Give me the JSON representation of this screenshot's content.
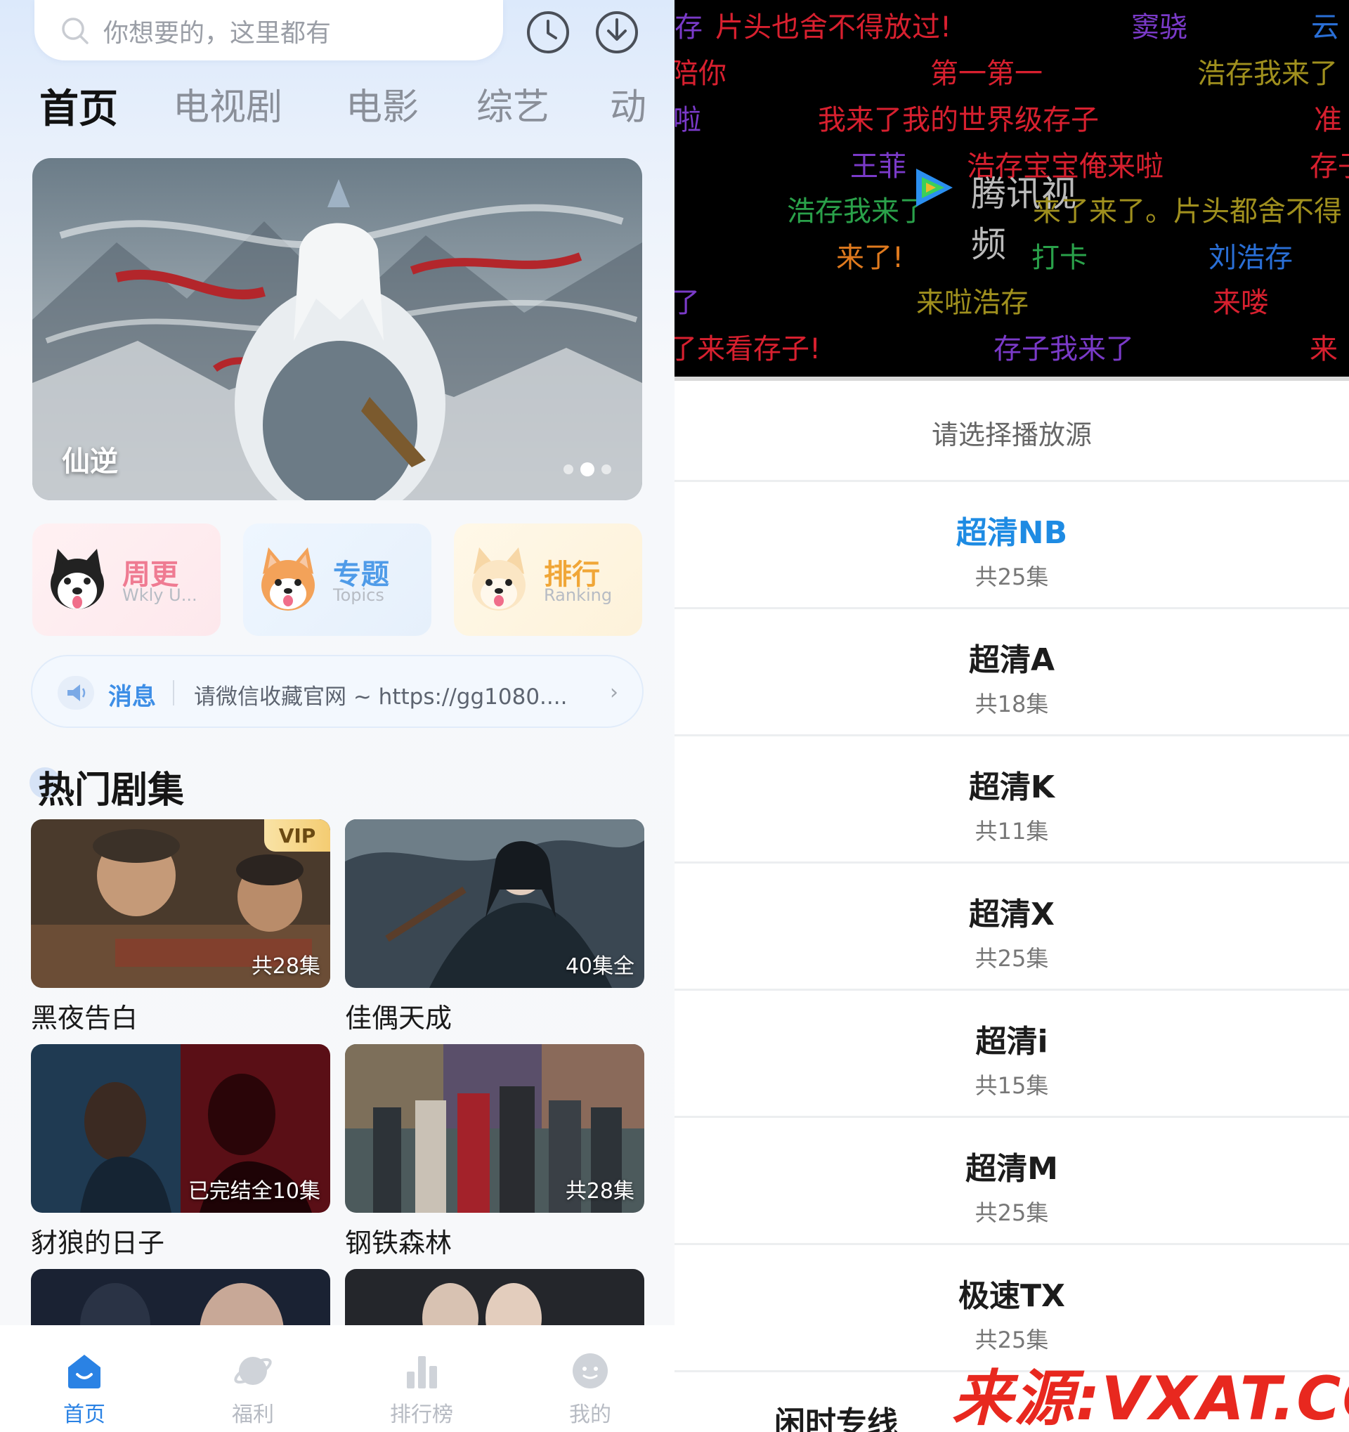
{
  "search": {
    "placeholder": "你想要的，这里都有"
  },
  "header_icons": [
    "history-icon",
    "download-icon"
  ],
  "tabs": [
    {
      "label": "首页",
      "active": true
    },
    {
      "label": "电视剧"
    },
    {
      "label": "电影"
    },
    {
      "label": "综艺"
    },
    {
      "label": "动"
    }
  ],
  "banner": {
    "title": "仙逆",
    "page_count": 3,
    "current_page": 2
  },
  "features": [
    {
      "title": "周更",
      "subtitle": "Wkly U...",
      "color": "#ef7b92",
      "icon": "husky-icon"
    },
    {
      "title": "专题",
      "subtitle": "Topics",
      "color": "#4f9be8",
      "icon": "corgi-icon"
    },
    {
      "title": "排行",
      "subtitle": "Ranking",
      "color": "#f0a637",
      "icon": "shiba-icon"
    }
  ],
  "notice": {
    "label": "消息",
    "text": "请微信收藏官网 ~ https://gg1080...."
  },
  "hot_section": {
    "title": "热门剧集",
    "items": [
      {
        "name": "黑夜告白",
        "badge": "共28集",
        "vip": "VIP"
      },
      {
        "name": "佳偶天成",
        "badge": "40集全"
      },
      {
        "name": "豺狼的日子",
        "badge": "已完结全10集"
      },
      {
        "name": "钢铁森林",
        "badge": "共28集"
      }
    ]
  },
  "bottom_nav": [
    {
      "label": "首页",
      "active": true,
      "icon": "home-icon"
    },
    {
      "label": "福利",
      "icon": "planet-icon"
    },
    {
      "label": "排行榜",
      "icon": "bar-chart-icon"
    },
    {
      "label": "我的",
      "icon": "profile-icon"
    }
  ],
  "player": {
    "logo_text": "腾讯视频",
    "danmaku": [
      "存",
      "片头也舍不得放过!",
      "窦骁",
      "云",
      "陪你",
      "第一第一",
      "浩存我来了",
      "啦",
      "我来了我的世界级存子",
      "准",
      "王菲",
      "浩存宝宝俺来啦",
      "存子",
      "浩存我来了",
      "来了来了。片头都舍不得",
      "来了!",
      "打卡",
      "刘浩存",
      "了",
      "来啦浩存",
      "来喽",
      "了来看存子!",
      "存子我来了",
      "来"
    ]
  },
  "source_picker": {
    "title": "请选择播放源",
    "sources": [
      {
        "name": "超清NB",
        "count": "共25集",
        "selected": true
      },
      {
        "name": "超清A",
        "count": "共18集"
      },
      {
        "name": "超清K",
        "count": "共11集"
      },
      {
        "name": "超清X",
        "count": "共25集"
      },
      {
        "name": "超清i",
        "count": "共15集"
      },
      {
        "name": "超清M",
        "count": "共25集"
      },
      {
        "name": "极速TX",
        "count": "共25集"
      },
      {
        "name": "闲时专线",
        "count": ""
      }
    ]
  },
  "watermark": "来源:VXAT.COM"
}
